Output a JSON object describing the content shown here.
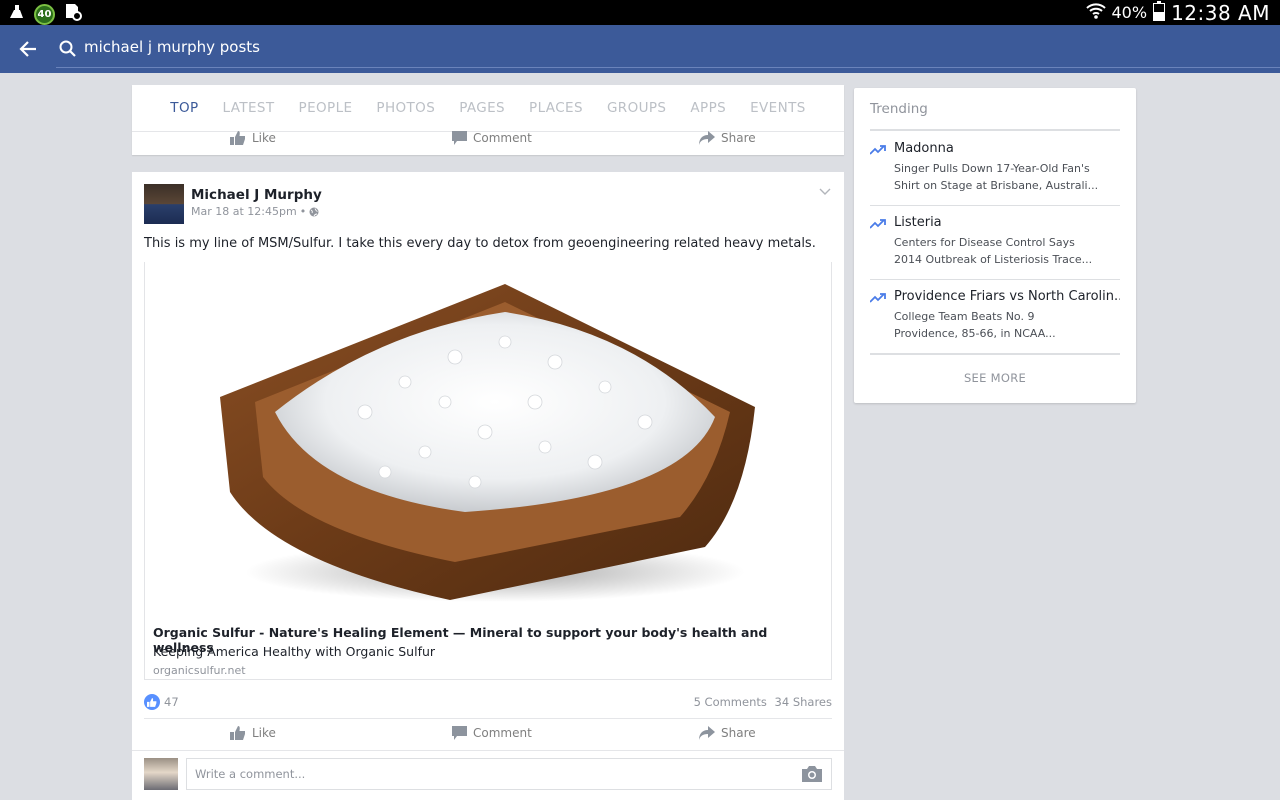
{
  "status_bar": {
    "notification_badge": "40",
    "battery_percent": "40%",
    "time": "12:38 AM"
  },
  "app_bar": {
    "search_query": "michael j murphy posts"
  },
  "tabs": [
    {
      "label": "TOP",
      "active": true
    },
    {
      "label": "LATEST",
      "active": false
    },
    {
      "label": "PEOPLE",
      "active": false
    },
    {
      "label": "PHOTOS",
      "active": false
    },
    {
      "label": "PAGES",
      "active": false
    },
    {
      "label": "PLACES",
      "active": false
    },
    {
      "label": "GROUPS",
      "active": false
    },
    {
      "label": "APPS",
      "active": false
    },
    {
      "label": "EVENTS",
      "active": false
    }
  ],
  "actions": {
    "like": "Like",
    "comment": "Comment",
    "share": "Share"
  },
  "post": {
    "author": "Michael J Murphy",
    "timestamp": "Mar 18 at 12:45pm",
    "meta_separator": "•",
    "text": "This is my line of MSM/Sulfur. I take this every day to detox from geoengineering related heavy metals.",
    "link": {
      "title": "Organic Sulfur - Nature's Healing Element — Mineral to support your body's health and wellness",
      "description": "Keeping America Healthy with Organic Sulfur",
      "domain": "organicsulfur.net"
    },
    "like_count": "47",
    "comments_count": "5 Comments",
    "shares_count": "34 Shares",
    "comment_placeholder": "Write a comment..."
  },
  "trending": {
    "header": "Trending",
    "items": [
      {
        "title": "Madonna",
        "desc_line1": "Singer Pulls Down 17-Year-Old Fan's",
        "desc_line2": "Shirt on Stage at Brisbane, Australi..."
      },
      {
        "title": "Listeria",
        "desc_line1": "Centers for Disease Control Says",
        "desc_line2": "2014 Outbreak of Listeriosis Trace..."
      },
      {
        "title": "Providence Friars vs North Carolin...",
        "desc_line1": "College Team Beats No. 9",
        "desc_line2": "Providence, 85-66, in NCAA..."
      }
    ],
    "see_more": "SEE MORE"
  },
  "colors": {
    "brand_blue": "#3c5a99",
    "trend_blue": "#4a7ce8",
    "like_blue": "#5890ff"
  },
  "icons": {
    "back": "arrow-left-icon",
    "search": "search-icon",
    "like": "thumbs-up-icon",
    "comment": "comment-bubble-icon",
    "share": "share-arrow-icon",
    "trend": "trend-arrow-icon",
    "camera": "camera-icon",
    "globe": "globe-icon",
    "chevron": "chevron-down-icon"
  }
}
